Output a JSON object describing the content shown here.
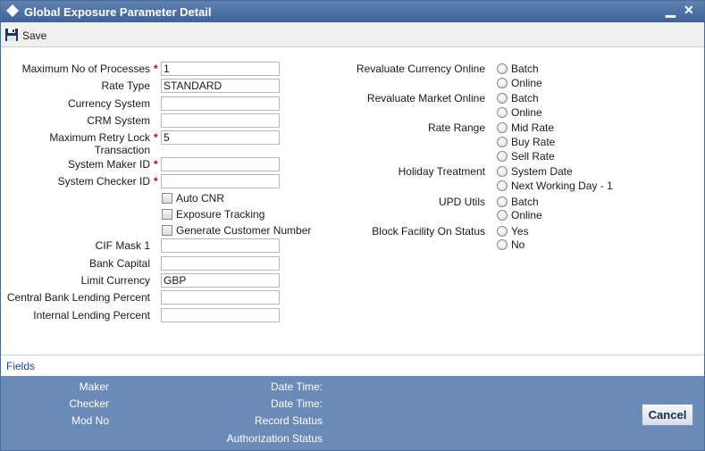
{
  "window": {
    "title": "Global Exposure Parameter Detail",
    "minimize": "▁",
    "close": "✕"
  },
  "toolbar": {
    "save_label": "Save"
  },
  "left_fields": {
    "max_processes": {
      "label": "Maximum No of Processes",
      "value": "1"
    },
    "rate_type": {
      "label": "Rate Type",
      "value": "STANDARD"
    },
    "currency_system": {
      "label": "Currency System",
      "value": ""
    },
    "crm_system": {
      "label": "CRM System",
      "value": ""
    },
    "max_retry": {
      "label_line1": "Maximum Retry Lock",
      "label_line2": "Transaction",
      "value": "5"
    },
    "maker_id": {
      "label": "System Maker ID",
      "value": ""
    },
    "checker_id": {
      "label": "System Checker ID",
      "value": ""
    },
    "cif_mask": {
      "label": "CIF Mask 1",
      "value": ""
    },
    "bank_capital": {
      "label": "Bank Capital",
      "value": ""
    },
    "limit_currency": {
      "label": "Limit Currency",
      "value": "GBP"
    },
    "cb_lending": {
      "label": "Central Bank Lending Percent",
      "value": ""
    },
    "internal_lending": {
      "label": "Internal Lending Percent",
      "value": ""
    }
  },
  "checkboxes": {
    "auto_cnr": "Auto CNR",
    "exposure_tracking": "Exposure Tracking",
    "generate_customer_number": "Generate Customer Number"
  },
  "right_fields": {
    "revaluate_currency": {
      "label": "Revaluate Currency Online",
      "options": [
        "Batch",
        "Online"
      ]
    },
    "revaluate_market": {
      "label": "Revaluate Market Online",
      "options": [
        "Batch",
        "Online"
      ]
    },
    "rate_range": {
      "label": "Rate Range",
      "options": [
        "Mid Rate",
        "Buy Rate",
        "Sell Rate"
      ]
    },
    "holiday_treatment": {
      "label": "Holiday Treatment",
      "options": [
        "System Date",
        "Next Working Day - 1"
      ]
    },
    "upd_utils": {
      "label": "UPD Utils",
      "options": [
        "Batch",
        "Online"
      ]
    },
    "block_facility": {
      "label": "Block Facility On Status",
      "options": [
        "Yes",
        "No"
      ]
    }
  },
  "required_mark": "*",
  "fields_link": "Fields",
  "footer": {
    "maker": "Maker",
    "checker": "Checker",
    "mod_no": "Mod No",
    "date_time_1": "Date Time:",
    "date_time_2": "Date Time:",
    "record_status": "Record Status",
    "authorization_status": "Authorization Status",
    "cancel_label": "Cancel"
  },
  "colors": {
    "title_bar": "#4a6d9c",
    "footer": "#6a8ab8",
    "required": "#d00000",
    "link": "#1f3fa8"
  }
}
